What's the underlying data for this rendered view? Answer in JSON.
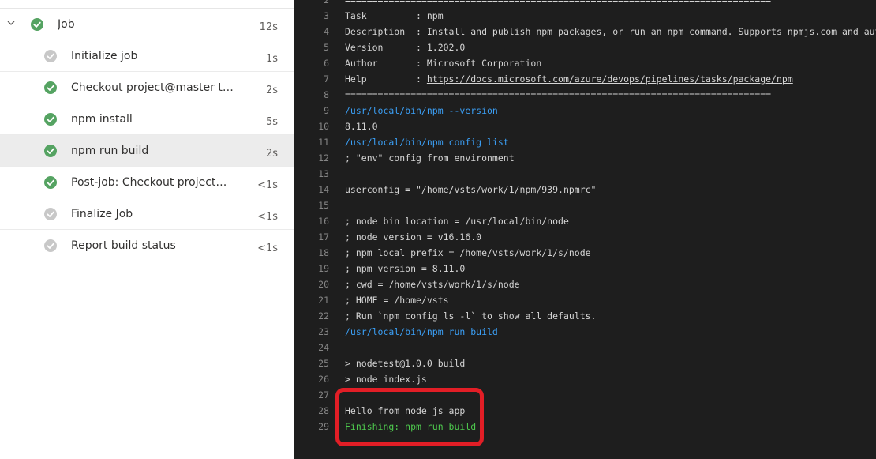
{
  "steps": [
    {
      "label": "Job",
      "duration": "12s",
      "status": "success"
    },
    {
      "label": "Initialize job",
      "duration": "1s",
      "status": "skipped"
    },
    {
      "label": "Checkout project@master to s",
      "duration": "2s",
      "status": "success"
    },
    {
      "label": "npm install",
      "duration": "5s",
      "status": "success"
    },
    {
      "label": "npm run build",
      "duration": "2s",
      "status": "success"
    },
    {
      "label": "Post-job: Checkout project@ma...",
      "duration": "<1s",
      "status": "success"
    },
    {
      "label": "Finalize Job",
      "duration": "<1s",
      "status": "skipped"
    },
    {
      "label": "Report build status",
      "duration": "<1s",
      "status": "skipped"
    }
  ],
  "log": [
    {
      "n": "2",
      "t": "==============================================================================",
      "k": "plain"
    },
    {
      "n": "3",
      "t": "Task         : npm",
      "k": "plain"
    },
    {
      "n": "4",
      "t": "Description  : Install and publish npm packages, or run an npm command. Supports npmjs.com and authent",
      "k": "plain"
    },
    {
      "n": "5",
      "t": "Version      : 1.202.0",
      "k": "plain"
    },
    {
      "n": "6",
      "t": "Author       : Microsoft Corporation",
      "k": "plain"
    },
    {
      "n": "7",
      "t": "Help         : ",
      "k": "plain",
      "link": "https://docs.microsoft.com/azure/devops/pipelines/tasks/package/npm"
    },
    {
      "n": "8",
      "t": "==============================================================================",
      "k": "plain"
    },
    {
      "n": "9",
      "t": "/usr/local/bin/npm --version",
      "k": "cmd"
    },
    {
      "n": "10",
      "t": "8.11.0",
      "k": "plain"
    },
    {
      "n": "11",
      "t": "/usr/local/bin/npm config list",
      "k": "cmd"
    },
    {
      "n": "12",
      "t": "; \"env\" config from environment",
      "k": "plain"
    },
    {
      "n": "13",
      "t": "",
      "k": "plain"
    },
    {
      "n": "14",
      "t": "userconfig = \"/home/vsts/work/1/npm/939.npmrc\"",
      "k": "plain"
    },
    {
      "n": "15",
      "t": "",
      "k": "plain"
    },
    {
      "n": "16",
      "t": "; node bin location = /usr/local/bin/node",
      "k": "plain"
    },
    {
      "n": "17",
      "t": "; node version = v16.16.0",
      "k": "plain"
    },
    {
      "n": "18",
      "t": "; npm local prefix = /home/vsts/work/1/s/node",
      "k": "plain"
    },
    {
      "n": "19",
      "t": "; npm version = 8.11.0",
      "k": "plain"
    },
    {
      "n": "20",
      "t": "; cwd = /home/vsts/work/1/s/node",
      "k": "plain"
    },
    {
      "n": "21",
      "t": "; HOME = /home/vsts",
      "k": "plain"
    },
    {
      "n": "22",
      "t": "; Run `npm config ls -l` to show all defaults.",
      "k": "plain"
    },
    {
      "n": "23",
      "t": "/usr/local/bin/npm run build",
      "k": "cmd"
    },
    {
      "n": "24",
      "t": "",
      "k": "plain"
    },
    {
      "n": "25",
      "t": "> nodetest@1.0.0 build",
      "k": "plain"
    },
    {
      "n": "26",
      "t": "> node index.js",
      "k": "plain"
    },
    {
      "n": "27",
      "t": "",
      "k": "plain"
    },
    {
      "n": "28",
      "t": "Hello from node js app",
      "k": "plain"
    },
    {
      "n": "29",
      "t": "Finishing: npm run build",
      "k": "ok"
    }
  ],
  "colors": {
    "success": "#55a362",
    "skipped": "#c8c8c8",
    "command": "#3b9ff5",
    "finished": "#4ec94e",
    "highlight": "#e21e26"
  }
}
